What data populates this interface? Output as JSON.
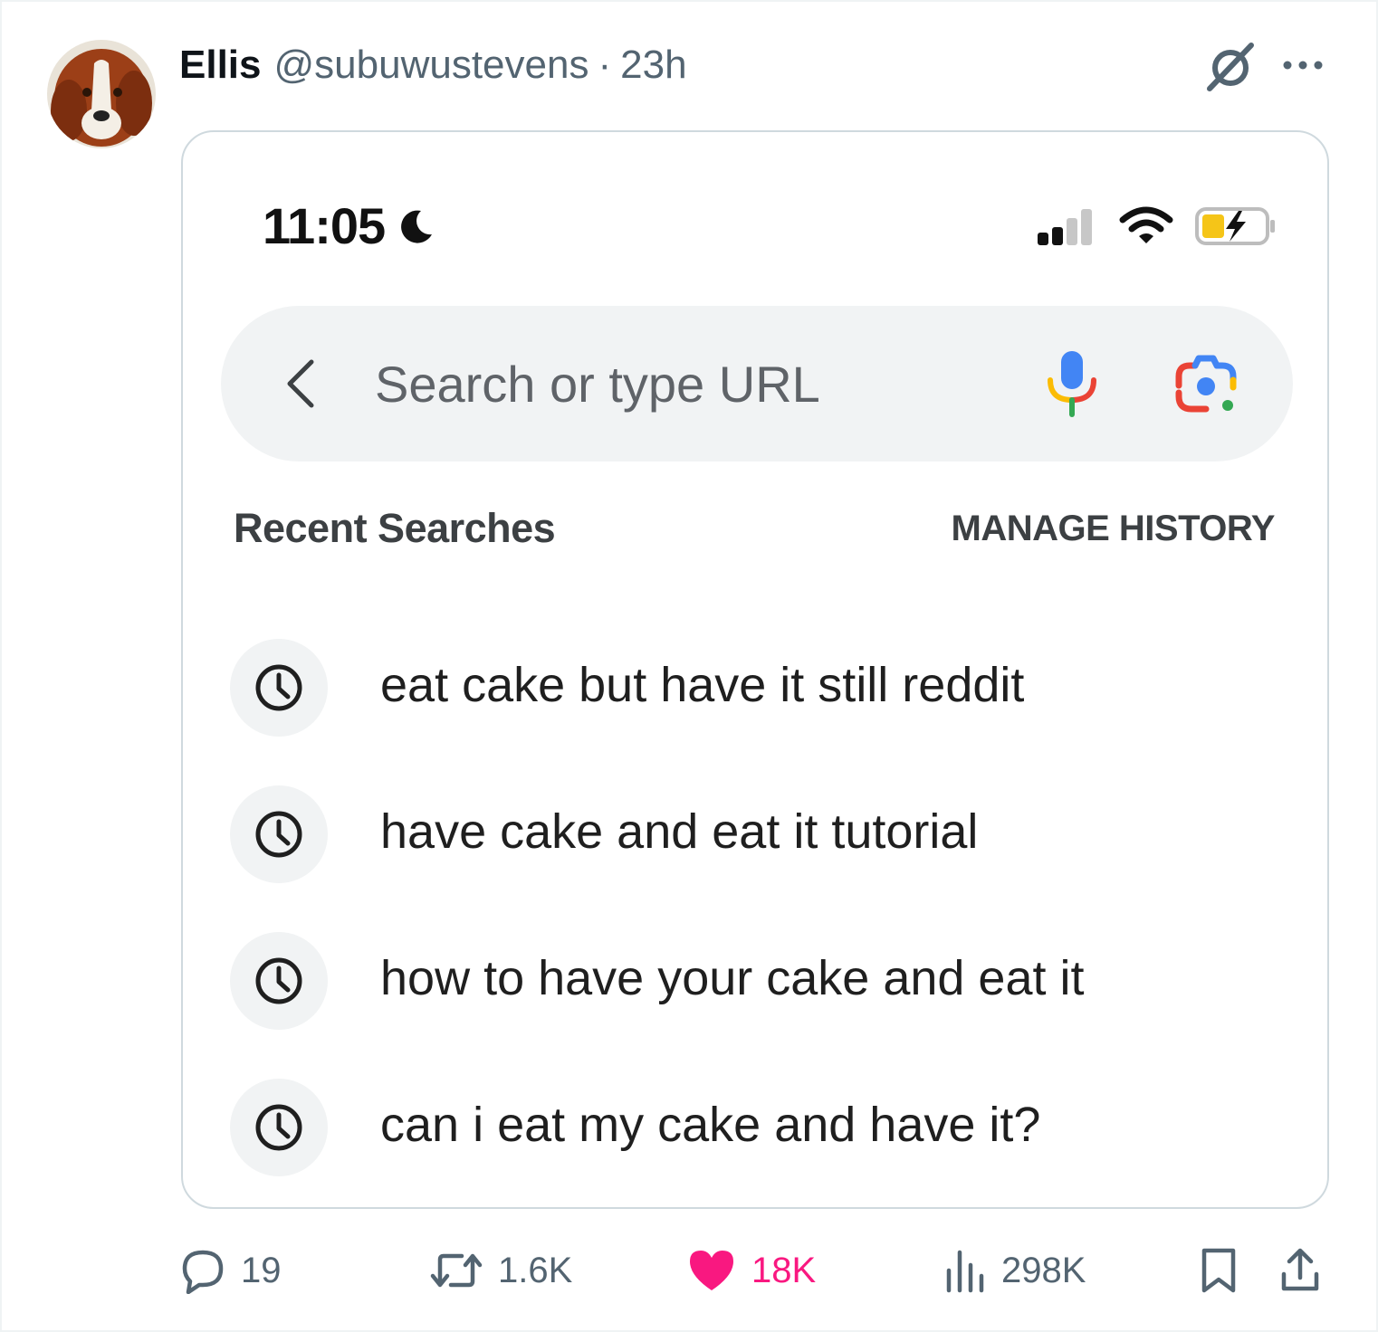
{
  "tweet": {
    "author_name": "Ellis",
    "author_handle": "@subuwustevens",
    "separator": "·",
    "time_ago": "23h"
  },
  "phone": {
    "status_time": "11:05",
    "search": {
      "placeholder": "Search or type URL"
    },
    "recent_heading": "Recent Searches",
    "manage_history_label": "MANAGE HISTORY",
    "history": [
      {
        "text": "eat cake but have it still reddit"
      },
      {
        "text": "have cake and eat it tutorial"
      },
      {
        "text": "how to have your cake and eat it"
      },
      {
        "text": "can i eat my cake and have it?"
      }
    ]
  },
  "engagement": {
    "replies": "19",
    "reposts": "1.6K",
    "likes": "18K",
    "views": "298K"
  },
  "colors": {
    "like": "#f91880",
    "muted": "#536471",
    "search_bg": "#f1f3f4",
    "google_blue": "#4285f4",
    "google_red": "#ea4335",
    "google_yellow": "#fbbc04",
    "google_green": "#34a853"
  },
  "icons": [
    "grok-icon",
    "more-icon",
    "moon-icon",
    "signal-icon",
    "wifi-icon",
    "battery-charging-icon",
    "back-chevron-icon",
    "mic-icon",
    "lens-icon",
    "clock-icon",
    "reply-icon",
    "repost-icon",
    "heart-icon",
    "views-icon",
    "bookmark-icon",
    "share-icon"
  ]
}
